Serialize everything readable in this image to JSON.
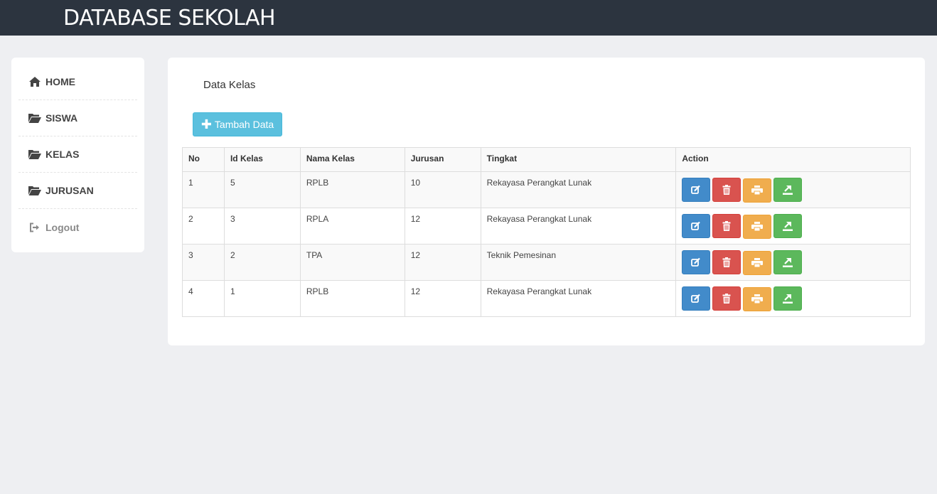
{
  "header": {
    "title": "DATABASE SEKOLAH"
  },
  "sidebar": {
    "items": [
      {
        "label": "HOME",
        "icon": "home-icon"
      },
      {
        "label": "SISWA",
        "icon": "folder-open-icon"
      },
      {
        "label": "KELAS",
        "icon": "folder-open-icon"
      },
      {
        "label": "JURUSAN",
        "icon": "folder-open-icon"
      },
      {
        "label": "Logout",
        "icon": "logout-icon"
      }
    ]
  },
  "main": {
    "title": "Data Kelas",
    "add_button": "Tambah Data",
    "table": {
      "headers": [
        "No",
        "Id Kelas",
        "Nama Kelas",
        "Jurusan",
        "Tingkat",
        "Action"
      ],
      "rows": [
        [
          "1",
          "5",
          "RPLB",
          "10",
          "Rekayasa Perangkat Lunak"
        ],
        [
          "2",
          "3",
          "RPLA",
          "12",
          "Rekayasa Perangkat Lunak"
        ],
        [
          "3",
          "2",
          "TPA",
          "12",
          "Teknik Pemesinan"
        ],
        [
          "4",
          "1",
          "RPLB",
          "12",
          "Rekayasa Perangkat Lunak"
        ]
      ]
    },
    "action_icons": [
      "edit-icon",
      "trash-icon",
      "print-icon",
      "export-icon"
    ]
  },
  "colors": {
    "topbar": "#2c343f",
    "background": "#eeeff2",
    "info": "#5bc0de",
    "primary": "#428bca",
    "danger": "#d9534f",
    "warning": "#f0ad4e",
    "success": "#5cb85c"
  }
}
